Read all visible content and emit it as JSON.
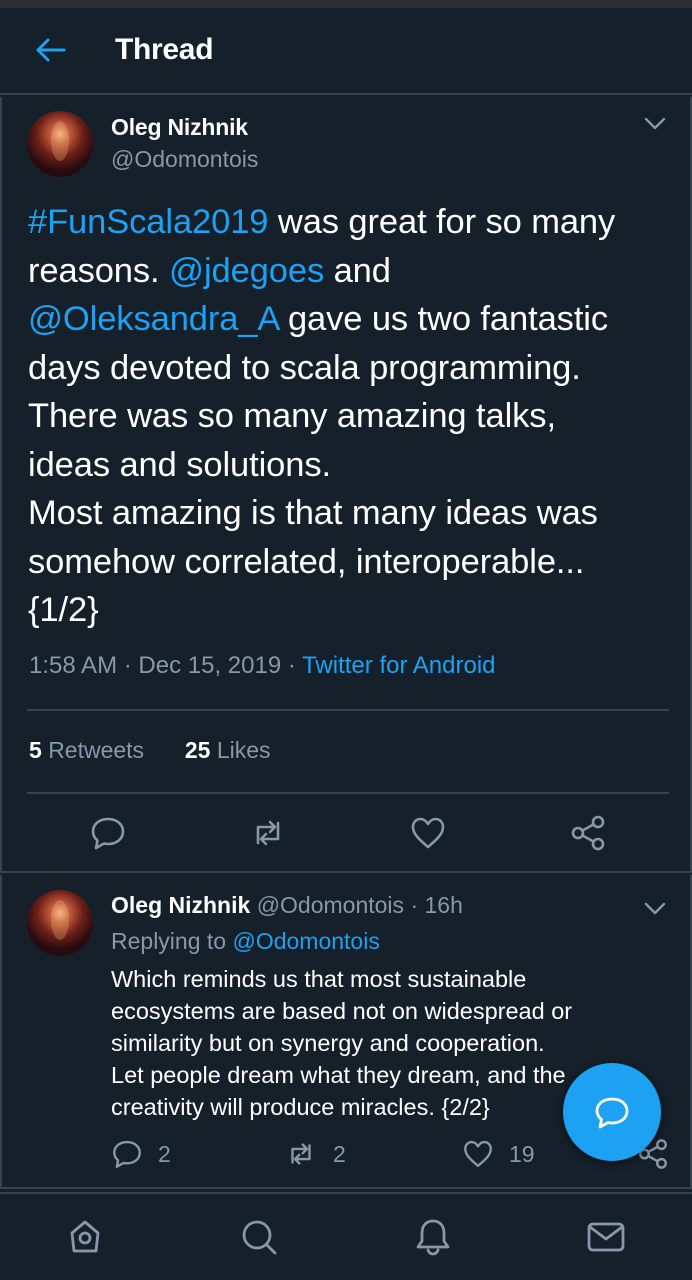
{
  "header": {
    "title": "Thread",
    "back_icon": "arrow-left-icon"
  },
  "main_tweet": {
    "author": {
      "name": "Oleg Nizhnik",
      "handle": "@Odomontois"
    },
    "text_lines": [
      [
        {
          "text": "#FunScala2019",
          "link": true
        },
        {
          "text": " was great for so many",
          "link": false
        }
      ],
      [
        {
          "text": "reasons. ",
          "link": false
        },
        {
          "text": "@jdegoes",
          "link": true
        },
        {
          "text": " and",
          "link": false
        }
      ],
      [
        {
          "text": "@Oleksandra_A",
          "link": true
        },
        {
          "text": " gave us two fantastic",
          "link": false
        }
      ],
      [
        {
          "text": "days devoted to scala programming.",
          "link": false
        }
      ],
      [
        {
          "text": "There was so many amazing talks,",
          "link": false
        }
      ],
      [
        {
          "text": "ideas and solutions.",
          "link": false
        }
      ],
      [
        {
          "text": "Most amazing is that many ideas was",
          "link": false
        }
      ],
      [
        {
          "text": "somehow correlated, interoperable...",
          "link": false
        }
      ],
      [
        {
          "text": "{1/2}",
          "link": false
        }
      ]
    ],
    "time": "1:58 AM",
    "date": "Dec 15, 2019",
    "source": "Twitter for Android",
    "retweets_count": "5",
    "retweets_label": "Retweets",
    "likes_count": "25",
    "likes_label": "Likes",
    "actions": [
      "reply-icon",
      "retweet-icon",
      "like-icon",
      "share-icon"
    ]
  },
  "reply_tweet": {
    "author": {
      "name": "Oleg Nizhnik",
      "handle": "@Odomontois"
    },
    "time_ago": "16h",
    "replying_prefix": "Replying to",
    "replying_to": "@Odomontois",
    "text_lines": [
      "Which reminds us that most sustainable",
      "ecosystems are based not on widespread or",
      "similarity but on synergy and cooperation.",
      "Let people dream what they dream, and the",
      "creativity will produce miracles. {2/2}"
    ],
    "reply_count": "2",
    "retweet_count": "2",
    "like_count": "19"
  },
  "fab": {
    "icon": "compose-reply-icon"
  },
  "bottom_nav": [
    "home-icon",
    "search-icon",
    "notifications-icon",
    "messages-icon"
  ],
  "colors": {
    "background": "#15202b",
    "accent": "#1da1f2",
    "muted": "#8899a6",
    "divider": "#38444d"
  }
}
